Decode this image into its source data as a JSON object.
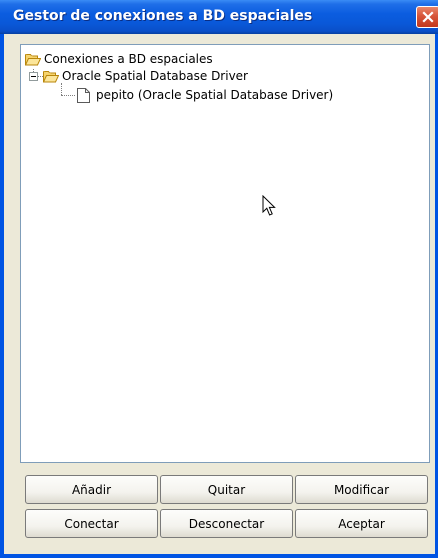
{
  "window": {
    "title": "Gestor de conexiones a BD espaciales"
  },
  "tree": {
    "root": {
      "label": "Conexiones a BD espaciales",
      "icon": "folder-open-icon"
    },
    "driver": {
      "label": "Oracle Spatial Database Driver",
      "icon": "folder-open-icon",
      "expanded": true
    },
    "connection": {
      "label": "pepito (Oracle Spatial Database Driver)",
      "icon": "document-icon"
    }
  },
  "buttons": {
    "add": "Añadir",
    "remove": "Quitar",
    "modify": "Modificar",
    "connect": "Conectar",
    "disconnect": "Desconectar",
    "accept": "Aceptar"
  },
  "colors": {
    "titlebar": "#0a58d8",
    "frame": "#0054e3",
    "dialog_background": "#ece9d8",
    "close_button": "#d7553a"
  }
}
